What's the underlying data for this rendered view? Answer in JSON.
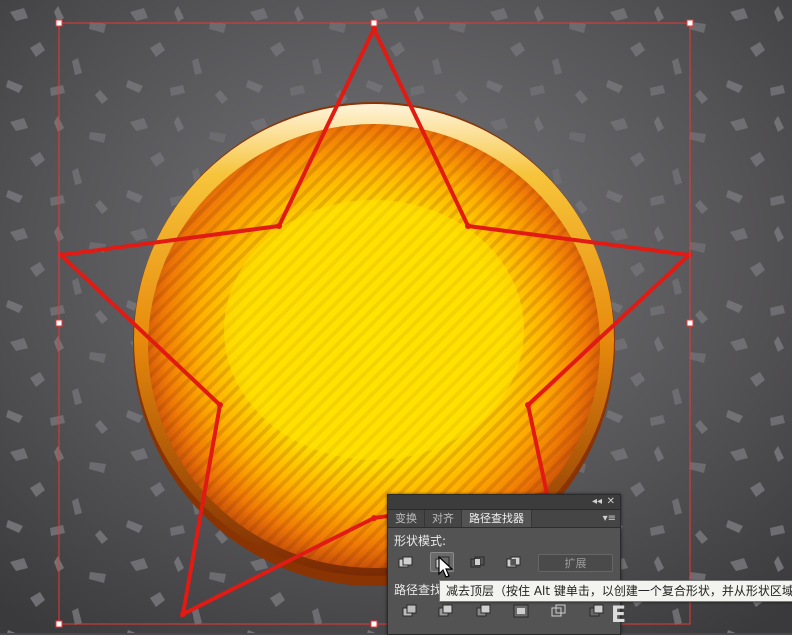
{
  "colors": {
    "background": "#4a4a4c",
    "selection": "#e83838",
    "star_stroke": "#e11a14",
    "circle_core": "#ffe300",
    "circle_rim": "#f09a10",
    "panel_bg": "#535353"
  },
  "panel": {
    "tabs": [
      {
        "label": "变换"
      },
      {
        "label": "对齐"
      },
      {
        "label": "路径查找器"
      }
    ],
    "collapse_icon": "◂◂",
    "close_icon": "✕",
    "menu_icon": "▾≡",
    "shape_modes_label": "形状模式:",
    "expand_label": "扩展",
    "pathfinders_label": "路径查找",
    "shape_mode_icons": [
      "unite-icon",
      "minus-front-icon",
      "intersect-icon",
      "exclude-icon"
    ],
    "pathfinder_icons": [
      "divide-icon",
      "trim-icon",
      "merge-icon",
      "crop-icon",
      "outline-icon",
      "minus-back-icon"
    ]
  },
  "tooltip": {
    "text": "减去顶层（按住 Alt 键单击，以创建一个复合形状，并从形状区域"
  },
  "watermark": "E"
}
